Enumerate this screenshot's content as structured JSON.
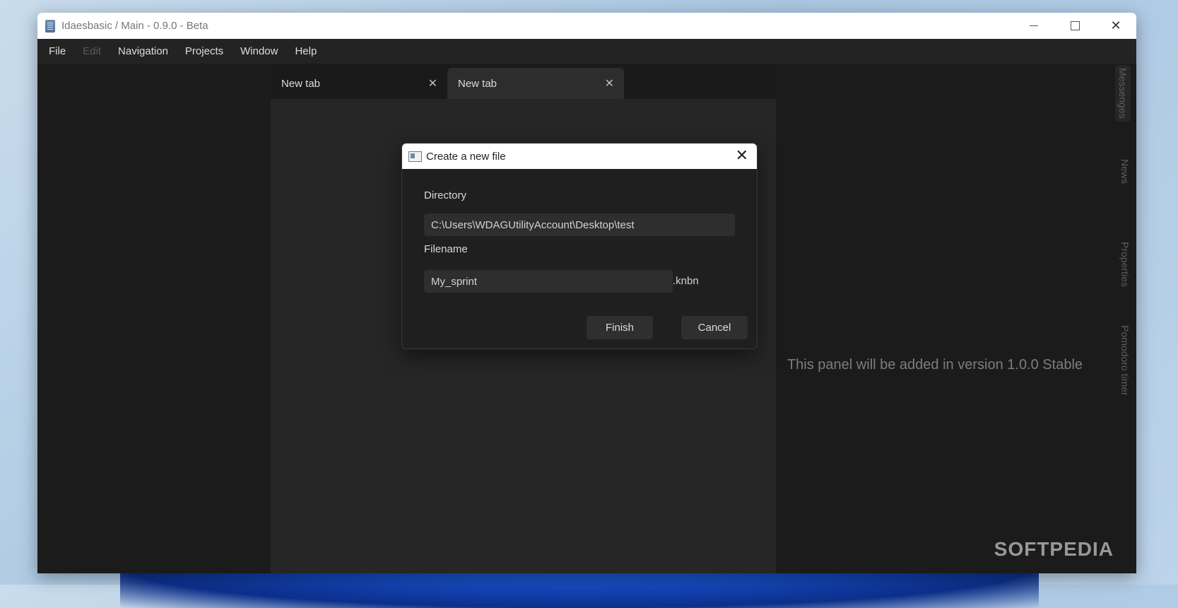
{
  "window": {
    "title": "Idaesbasic / Main - 0.9.0 - Beta",
    "controls": {
      "minimize": "minimize-icon",
      "maximize": "maximize-icon",
      "close": "✕"
    }
  },
  "menu": [
    "File",
    "Edit",
    "Navigation",
    "Projects",
    "Window",
    "Help"
  ],
  "tabs": [
    {
      "label": "New tab",
      "close": "✕",
      "active": false
    },
    {
      "label": "New tab",
      "close": "✕",
      "active": true
    }
  ],
  "right_panel": {
    "message": "This panel will be added in version 1.0.0 Stable",
    "side_items": [
      "Messenges",
      "News",
      "Properties",
      "Pomodoro timer"
    ]
  },
  "dialog": {
    "title": "Create a new file",
    "close": "✕",
    "directory_label": "Directory",
    "directory_value": "C:\\Users\\WDAGUtilityAccount\\Desktop\\test",
    "filename_label": "Filename",
    "filename_value": "My_sprint",
    "extension": ".knbn",
    "finish": "Finish",
    "cancel": "Cancel"
  },
  "watermark": "SOFTPEDIA"
}
